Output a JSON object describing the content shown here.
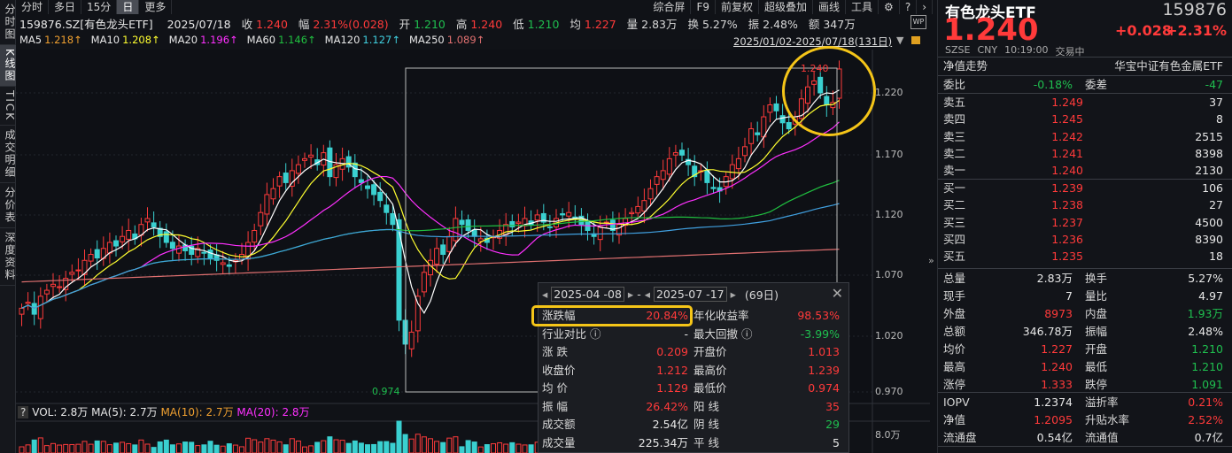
{
  "left_tabs": [
    "分时图",
    "K线图",
    "TICK",
    "成交明细",
    "分价表",
    "深度资料"
  ],
  "toolbar": {
    "left": [
      "分时",
      "多日",
      "15分",
      "日",
      "更多"
    ],
    "right": [
      "综合屏",
      "F9",
      "前复权",
      "超级叠加",
      "画线",
      "工具"
    ]
  },
  "info": {
    "code": "159876.SZ[有色龙头ETF]",
    "date": "2025/07/18",
    "close_label": "收",
    "close": "1.240",
    "chg_label": "幅",
    "chg": "2.31%(0.028)",
    "open_label": "开",
    "open": "1.210",
    "high_label": "高",
    "high": "1.240",
    "low_label": "低",
    "low": "1.210",
    "avg_label": "均",
    "avg": "1.227",
    "vol_label": "量",
    "vol": "2.83万",
    "turn_label": "换",
    "turn": "5.27%",
    "amp_label": "振",
    "amp": "2.48%",
    "amt_label": "额",
    "amt": "347万"
  },
  "ma": [
    {
      "label": "MA5",
      "value": "1.218↑",
      "color": "#f0a030"
    },
    {
      "label": "MA10",
      "value": "1.208↑",
      "color": "#ffff30"
    },
    {
      "label": "MA20",
      "value": "1.196↑",
      "color": "#ff30ff"
    },
    {
      "label": "MA60",
      "value": "1.146↑",
      "color": "#20c040"
    },
    {
      "label": "MA120",
      "value": "1.127↑",
      "color": "#40d0e0"
    },
    {
      "label": "MA250",
      "value": "1.089↑",
      "color": "#e07070"
    }
  ],
  "range_label": "2025/01/02-2025/07/18(131日)",
  "wp_badge": "WP",
  "price_axis": [
    "1.220",
    "1.170",
    "1.120",
    "1.070",
    "1.020",
    "0.970"
  ],
  "vol_axis": "8.0万",
  "selection": {
    "high_label": "1.240",
    "low_label": "0.974"
  },
  "volume_header": {
    "help": "?",
    "vol": "VOL: 2.8万",
    "ma5": "MA(5): 2.7万",
    "ma10": "MA(10): 2.7万",
    "ma20": "MA(20): 2.8万"
  },
  "popup": {
    "start": "2025-04 -08",
    "sep": "-",
    "end": "2025-07 -17",
    "days": "(69日)",
    "rows": [
      [
        "涨跌幅",
        "20.84%",
        "r",
        "年化收益率",
        "98.53%",
        "r"
      ],
      [
        "行业对比 ⓘ",
        "-",
        "w",
        "最大回撤 ⓘ",
        "-3.99%",
        "g"
      ],
      [
        "涨  跌",
        "0.209",
        "r",
        "开盘价",
        "1.013",
        "r"
      ],
      [
        "收盘价",
        "1.212",
        "r",
        "最高价",
        "1.239",
        "r"
      ],
      [
        "均  价",
        "1.129",
        "r",
        "最低价",
        "0.974",
        "r"
      ],
      [
        "振  幅",
        "26.42%",
        "r",
        "阳  线",
        "35",
        "r"
      ],
      [
        "成交额",
        "2.54亿",
        "w",
        "阴  线",
        "29",
        "g"
      ],
      [
        "成交量",
        "225.34万",
        "w",
        "平  线",
        "5",
        "w"
      ]
    ]
  },
  "quote": {
    "name": "有色龙头ETF",
    "code": "159876",
    "price": "1.240",
    "change": "+0.028",
    "pct": "+2.31%",
    "market": "SZSE",
    "currency": "CNY",
    "time": "10:19:00",
    "status": "交易中",
    "nav_trend": "净值走势",
    "full_name": "华宝中证有色金属ETF",
    "wei_bi_label": "委比",
    "wei_bi": "-0.18%",
    "wei_cha_label": "委差",
    "wei_cha": "-47",
    "asks": [
      [
        "卖五",
        "1.249",
        "37"
      ],
      [
        "卖四",
        "1.245",
        "8"
      ],
      [
        "卖三",
        "1.242",
        "2515"
      ],
      [
        "卖二",
        "1.241",
        "8398"
      ],
      [
        "卖一",
        "1.240",
        "2130"
      ]
    ],
    "bids": [
      [
        "买一",
        "1.239",
        "106"
      ],
      [
        "买二",
        "1.238",
        "27"
      ],
      [
        "买三",
        "1.237",
        "4500"
      ],
      [
        "买四",
        "1.236",
        "8390"
      ],
      [
        "买五",
        "1.235",
        "18"
      ]
    ],
    "stats": [
      [
        "总量",
        "2.83万",
        "w",
        "换手",
        "5.27%",
        "w"
      ],
      [
        "现手",
        "7",
        "w",
        "量比",
        "4.97",
        "w"
      ],
      [
        "外盘",
        "8973",
        "r",
        "内盘",
        "1.93万",
        "g"
      ],
      [
        "总额",
        "346.78万",
        "w",
        "振幅",
        "2.48%",
        "w"
      ],
      [
        "均价",
        "1.227",
        "r",
        "开盘",
        "1.210",
        "g"
      ],
      [
        "最高",
        "1.240",
        "r",
        "最低",
        "1.210",
        "g"
      ],
      [
        "涨停",
        "1.333",
        "r",
        "跌停",
        "1.091",
        "g"
      ]
    ],
    "etf": [
      [
        "IOPV",
        "1.2374",
        "w",
        "溢折率",
        "0.21%",
        "r"
      ],
      [
        "净值",
        "1.2095",
        "r",
        "升贴水率",
        "2.52%",
        "r"
      ],
      [
        "流通盘",
        "0.54亿",
        "w",
        "流通值",
        "0.7亿",
        "w"
      ]
    ]
  },
  "chart_data": {
    "type": "candlestick",
    "title": "159876.SZ 日K",
    "ylim": [
      0.97,
      1.25
    ],
    "closes": [
      1.04,
      1.045,
      1.035,
      1.05,
      1.055,
      1.06,
      1.058,
      1.065,
      1.07,
      1.072,
      1.08,
      1.085,
      1.082,
      1.09,
      1.095,
      1.092,
      1.1,
      1.105,
      1.098,
      1.11,
      1.115,
      1.108,
      1.1,
      1.095,
      1.09,
      1.092,
      1.088,
      1.085,
      1.09,
      1.086,
      1.082,
      1.08,
      1.078,
      1.075,
      1.08,
      1.085,
      1.095,
      1.105,
      1.12,
      1.135,
      1.14,
      1.15,
      1.145,
      1.155,
      1.16,
      1.165,
      1.168,
      1.16,
      1.17,
      1.15,
      1.16,
      1.165,
      1.158,
      1.15,
      1.145,
      1.14,
      1.135,
      1.13,
      1.12,
      1.11,
      1.03,
      1.01,
      1.02,
      1.05,
      1.07,
      1.08,
      1.09,
      1.085,
      1.1,
      1.115,
      1.11,
      1.105,
      1.1,
      1.098,
      1.095,
      1.1,
      1.105,
      1.11,
      1.108,
      1.112,
      1.115,
      1.11,
      1.118,
      1.112,
      1.108,
      1.115,
      1.118,
      1.12,
      1.115,
      1.11,
      1.105,
      1.1,
      1.108,
      1.112,
      1.105,
      1.11,
      1.115,
      1.12,
      1.125,
      1.13,
      1.14,
      1.15,
      1.155,
      1.165,
      1.17,
      1.168,
      1.16,
      1.15,
      1.155,
      1.145,
      1.14,
      1.138,
      1.15,
      1.16,
      1.165,
      1.175,
      1.19,
      1.185,
      1.2,
      1.21,
      1.205,
      1.195,
      1.19,
      1.2,
      1.215,
      1.225,
      1.23,
      1.22,
      1.21,
      1.212,
      1.24
    ]
  }
}
